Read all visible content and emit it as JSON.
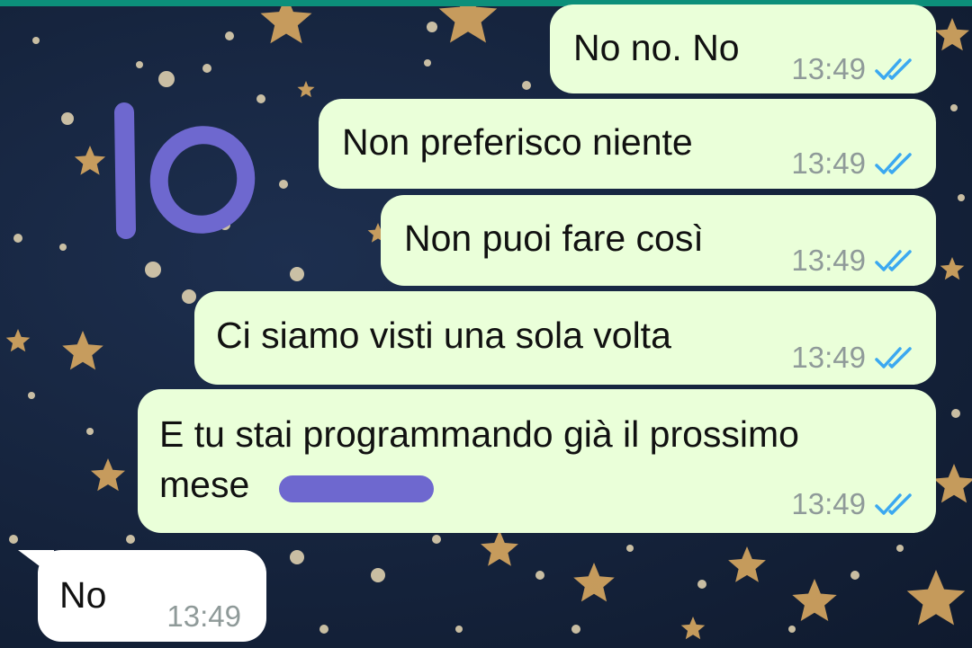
{
  "colors": {
    "header_accent": "#0c8f7a",
    "outgoing_bubble": "#eaffd9",
    "incoming_bubble": "#ffffff",
    "read_ticks": "#3ba8f0",
    "timestamp": "#8f9a99",
    "annotation_ink": "#6e68cf",
    "wallpaper": "#15233c",
    "stars": "#d9a860"
  },
  "annotation": {
    "handwritten_label": "Io"
  },
  "messages": [
    {
      "direction": "outgoing",
      "text": "No no. No",
      "time": "13:49",
      "status": "read",
      "status_icon": "double-check-icon"
    },
    {
      "direction": "outgoing",
      "text": "Non preferisco niente",
      "time": "13:49",
      "status": "read",
      "status_icon": "double-check-icon"
    },
    {
      "direction": "outgoing",
      "text": "Non puoi fare così",
      "time": "13:49",
      "status": "read",
      "status_icon": "double-check-icon"
    },
    {
      "direction": "outgoing",
      "text": "Ci siamo visti una sola volta",
      "time": "13:49",
      "status": "read",
      "status_icon": "double-check-icon"
    },
    {
      "direction": "outgoing",
      "text_line1": "E tu stai programmando già il prossimo",
      "text_line2": "mese",
      "redacted": true,
      "time": "13:49",
      "status": "read",
      "status_icon": "double-check-icon"
    },
    {
      "direction": "incoming",
      "text": "No",
      "time": "13:49"
    }
  ]
}
